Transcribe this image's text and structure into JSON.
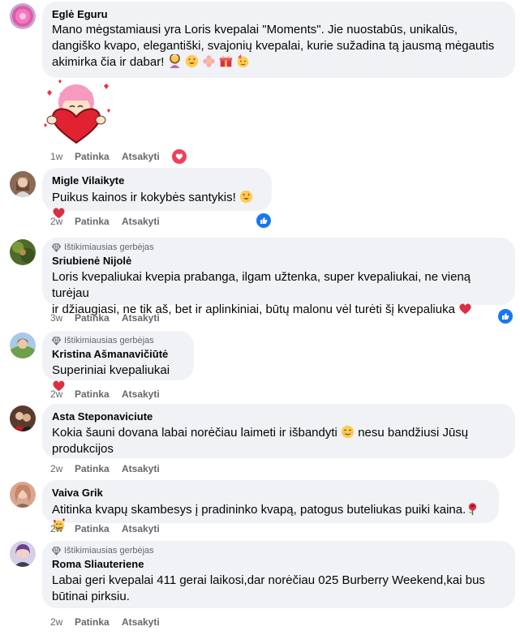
{
  "comments": [
    {
      "author": "Eglė Eguru",
      "badge": "",
      "text": "Mano mėgstamiausi yra Loris kvepalai \"Moments\". Jie nuostabūs, unikalūs, dangiško kvapo, elegantiški, svajonių kvepalai, kurie sužadina tą jausmą mėgautis akimirka čia ir dabar!",
      "time": "1w",
      "like": "Patinka",
      "reply": "Atsakyti",
      "reaction": "love"
    },
    {
      "author": "Migle Vilaikyte",
      "badge": "",
      "text": "Puikus kainos ir kokybės santykis!",
      "time": "2w",
      "like": "Patinka",
      "reply": "Atsakyti",
      "reaction": "like"
    },
    {
      "author": "Sriubienė Nijolė",
      "badge": "Ištikimiausias gerbėjas",
      "text_line1": "Loris kvepaliukai kvepia prabanga, ilgam užtenka, super kvepaliukai, ne vieną turėjau",
      "text_line2": "ir džiaugiasi, ne tik aš, bet ir aplinkiniai, būtų malonu vėl turėti šį kvepaliuka",
      "time": "3w",
      "like": "Patinka",
      "reply": "Atsakyti",
      "reaction": "like"
    },
    {
      "author": "Kristina Ašmanavičiūtė",
      "badge": "Ištikimiausias gerbėjas",
      "text": "Superiniai kvepaliukai",
      "time": "2w",
      "like": "Patinka",
      "reply": "Atsakyti",
      "reaction": ""
    },
    {
      "author": "Asta Steponaviciute",
      "badge": "",
      "text_line1": "Kokia šauni dovana labai norėčiau laimeti ir išbandyti",
      "text_line1b": "nesu bandžiusi Jūsų",
      "text_line2": "produkcijos",
      "time": "2w",
      "like": "Patinka",
      "reply": "Atsakyti",
      "reaction": ""
    },
    {
      "author": "Vaiva Grik",
      "badge": "",
      "text": "Atitinka kvapų skambesys į pradininko kvapą, patogus buteliukas puiki kaina.",
      "time": "2w",
      "like": "Patinka",
      "reply": "Atsakyti",
      "reaction": ""
    },
    {
      "author": "Roma Sliauteriene",
      "badge": "Ištikimiausias gerbėjas",
      "text_line1": "Labai geri kvepalai 411 gerai laikosi,dar norėčiau 025 Burberry Weekend,kai bus",
      "text_line2": "būtinai pirksiu.",
      "time": "2w",
      "like": "Patinka",
      "reply": "Atsakyti",
      "reaction": ""
    }
  ],
  "sticker": "heart-hug-sticker",
  "colors": {
    "bubble": "#f0f2f5",
    "meta": "#65676b",
    "like_blue": "#1877f2",
    "love_red": "#f33e58"
  }
}
